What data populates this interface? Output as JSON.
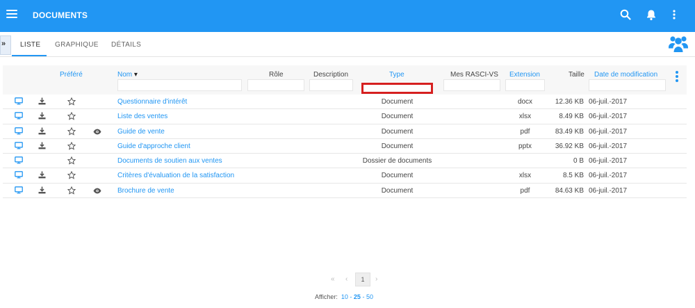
{
  "app": {
    "title": "DOCUMENTS"
  },
  "colors": {
    "primary": "#2196f3",
    "highlight": "#d62020"
  },
  "icons": {
    "menu": "menu-icon",
    "search": "search-icon",
    "notifications": "bell-icon",
    "more": "more-vert-icon",
    "team": "team-icon",
    "preview": "monitor-icon",
    "download": "download-icon",
    "favorite": "star-outline-icon",
    "watch": "eye-icon"
  },
  "sidebar_toggle": {
    "label": "»"
  },
  "tabs": [
    {
      "label": "LISTE",
      "active": true
    },
    {
      "label": "GRAPHIQUE",
      "active": false
    },
    {
      "label": "DÉTAILS",
      "active": false
    }
  ],
  "table": {
    "headers": {
      "favorite": "Préféré",
      "name": "Nom",
      "name_sort": "▾",
      "role": "Rôle",
      "description": "Description",
      "type": "Type",
      "rasci": "Mes RASCI-VS",
      "extension": "Extension",
      "size": "Taille",
      "modified": "Date de modification"
    },
    "rows": [
      {
        "name": "Questionnaire d'intérêt",
        "type": "Document",
        "extension": "docx",
        "size": "12.36 KB",
        "modified": "06-juil.-2017"
      },
      {
        "name": "Liste des ventes",
        "type": "Document",
        "extension": "xlsx",
        "size": "8.49 KB",
        "modified": "06-juil.-2017"
      },
      {
        "name": "Guide de vente",
        "type": "Document",
        "extension": "pdf",
        "size": "83.49 KB",
        "modified": "06-juil.-2017"
      },
      {
        "name": "Guide d'approche client",
        "type": "Document",
        "extension": "pptx",
        "size": "36.92 KB",
        "modified": "06-juil.-2017"
      },
      {
        "name": "Documents de soutien aux ventes",
        "type": "Dossier de documents",
        "extension": "",
        "size": "0 B",
        "modified": "06-juil.-2017"
      },
      {
        "name": "Critères d'évaluation de la satisfaction",
        "type": "Document",
        "extension": "xlsx",
        "size": "8.5 KB",
        "modified": "06-juil.-2017"
      },
      {
        "name": "Brochure de vente",
        "type": "Document",
        "extension": "pdf",
        "size": "84.63 KB",
        "modified": "06-juil.-2017"
      }
    ]
  },
  "pagination": {
    "first": "«",
    "prev": "‹",
    "current_page": "1",
    "next": "›",
    "show_label": "Afficher:",
    "page_sizes": [
      "10",
      "25",
      "50"
    ],
    "separator": "-"
  }
}
